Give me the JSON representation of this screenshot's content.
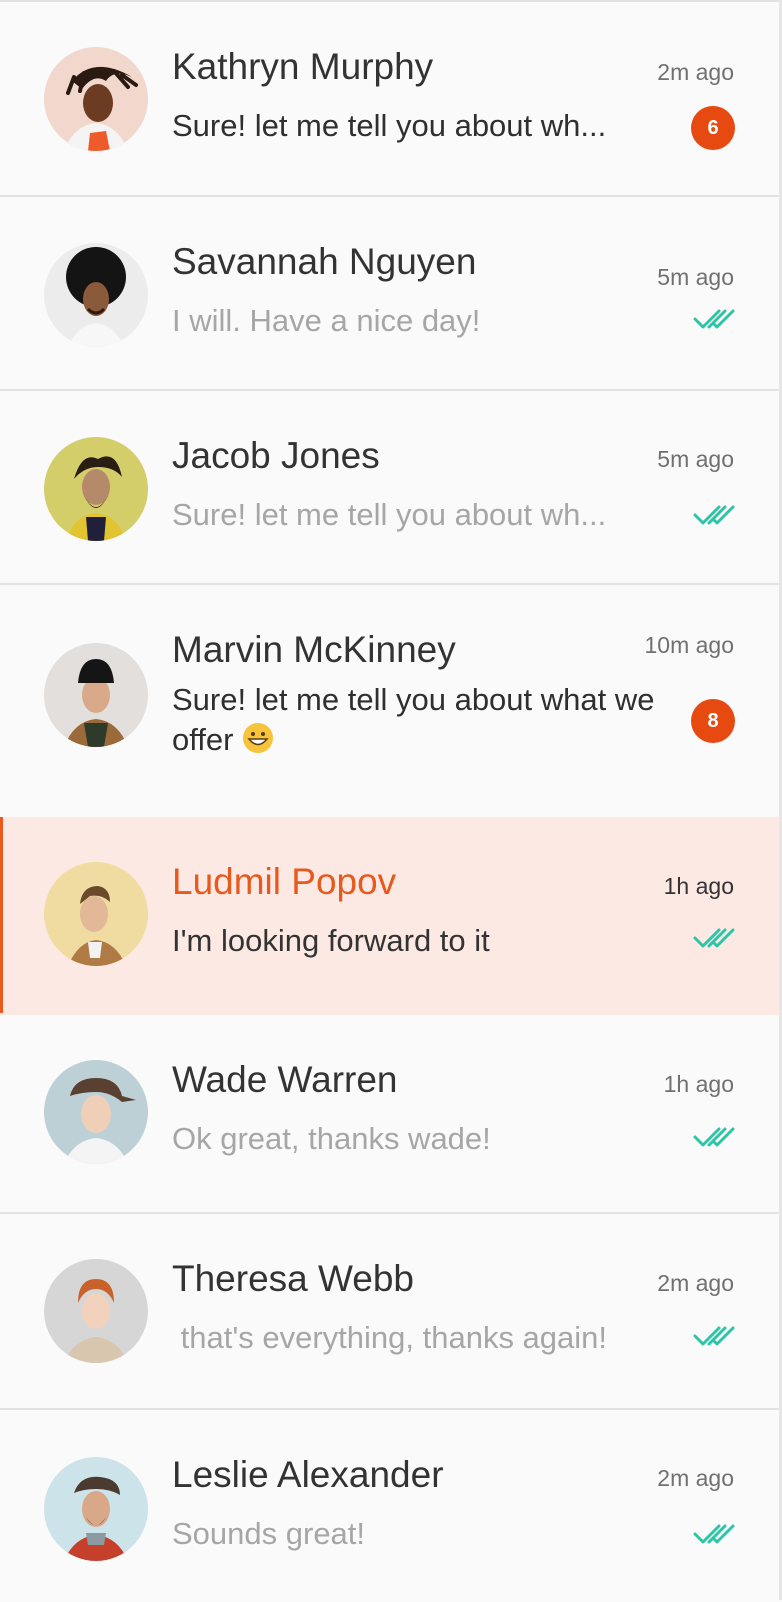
{
  "conversations": [
    {
      "name": "Kathryn Murphy",
      "time": "2m ago",
      "message": "Sure! let me tell you about wh...",
      "unread_count": "6",
      "status": "unread",
      "avatar_icon": "avatar-photo",
      "avatar_bg": "#f2d8cc"
    },
    {
      "name": "Savannah Nguyen",
      "time": "5m ago",
      "message": "I will. Have a nice day!",
      "status": "read",
      "avatar_icon": "avatar-photo",
      "avatar_bg": "#ececec"
    },
    {
      "name": "Jacob Jones",
      "time": "5m ago",
      "message": "Sure! let me tell you about wh...",
      "status": "read",
      "avatar_icon": "avatar-photo",
      "avatar_bg": "#d4ce6a"
    },
    {
      "name": "Marvin McKinney",
      "time": "10m ago",
      "message": "Sure! let me tell you about what we offer",
      "emoji": "grinning-face",
      "unread_count": "8",
      "status": "unread",
      "avatar_icon": "avatar-photo",
      "avatar_bg": "#e3dfdc"
    },
    {
      "name": "Ludmil Popov",
      "time": "1h ago",
      "message": "I'm looking forward to it",
      "status": "read",
      "selected": true,
      "avatar_icon": "avatar-photo",
      "avatar_bg": "#f0dca0"
    },
    {
      "name": "Wade Warren",
      "time": "1h ago",
      "message": "Ok great, thanks wade!",
      "status": "read",
      "avatar_icon": "avatar-photo",
      "avatar_bg": "#bcd0d6"
    },
    {
      "name": "Theresa Webb",
      "time": "2m ago",
      "message": " that's everything, thanks again!",
      "status": "read",
      "avatar_icon": "avatar-photo",
      "avatar_bg": "#d6d6d6"
    },
    {
      "name": "Leslie Alexander",
      "time": "2m ago",
      "message": "Sounds great!",
      "status": "read",
      "avatar_icon": "avatar-photo",
      "avatar_bg": "#cde3ea"
    }
  ],
  "colors": {
    "accent": "#e65a1e",
    "badge": "#e64a10",
    "read_check": "#2ec4a6",
    "selected_bg": "#fde9e4"
  }
}
